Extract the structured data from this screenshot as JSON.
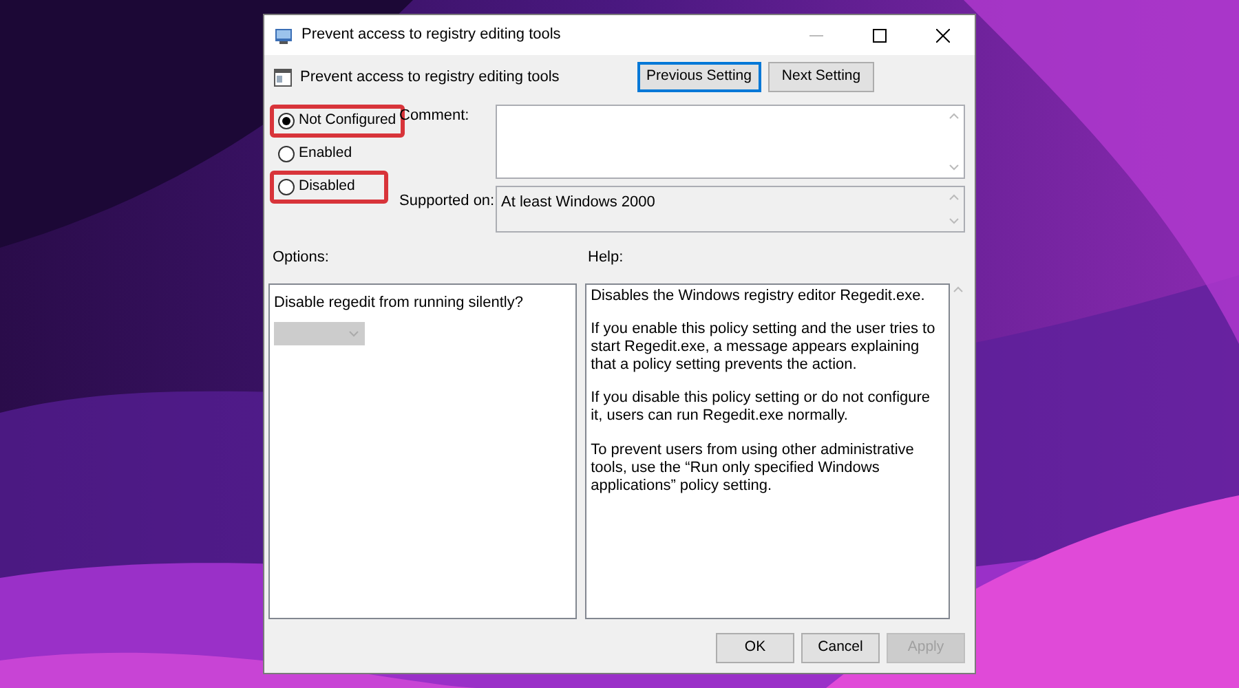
{
  "window": {
    "title": "Prevent access to registry editing tools"
  },
  "header": {
    "title": "Prevent access to registry editing tools",
    "buttons": [
      {
        "label": "Previous Setting",
        "focused": true
      },
      {
        "label": "Next Setting",
        "focused": false
      }
    ]
  },
  "state_options": [
    {
      "label": "Not Configured",
      "selected": true,
      "highlighted": true
    },
    {
      "label": "Enabled",
      "selected": false,
      "highlighted": false
    },
    {
      "label": "Disabled",
      "selected": false,
      "highlighted": true
    }
  ],
  "comment": {
    "label": "Comment:"
  },
  "supported_on": {
    "label": "Supported on:",
    "value": "At least Windows 2000"
  },
  "options": {
    "label": "Options:",
    "prompt": "Disable regedit from running silently?",
    "dropdown_disabled": true
  },
  "help": {
    "label": "Help:",
    "paragraphs": [
      "Disables the Windows registry editor Regedit.exe.",
      "If you enable this policy setting and the user tries to start Regedit.exe, a message appears explaining that a policy setting prevents the action.",
      "If you disable this policy setting or do not configure it, users can run Regedit.exe normally.",
      "To prevent users from using other administrative tools, use the “Run only specified Windows applications” policy setting."
    ]
  },
  "buttons": [
    {
      "label": "OK",
      "disabled": false
    },
    {
      "label": "Cancel",
      "disabled": false
    },
    {
      "label": "Apply",
      "disabled": true
    }
  ]
}
